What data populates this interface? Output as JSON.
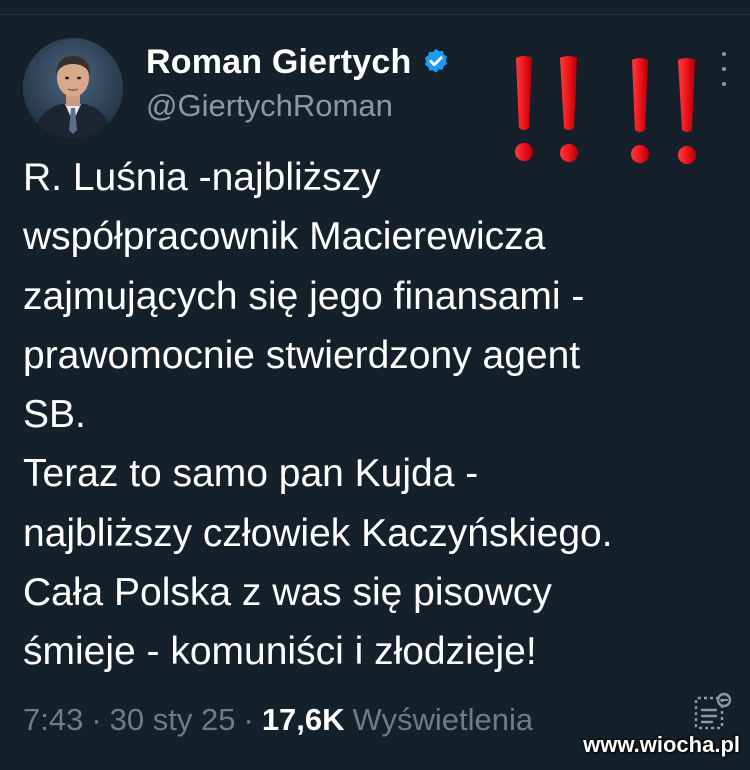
{
  "tweet": {
    "author": {
      "display_name": "Roman Giertych",
      "handle": "@GiertychRoman",
      "verified": true,
      "verified_color": "#1d9bf0"
    },
    "text_lines": [
      "R. Luśnia -najbliższy",
      "współpracownik Macierewicza",
      "zajmujących się jego finansami -",
      "prawomocnie stwierdzony agent",
      "SB.",
      "Teraz to samo pan Kujda -",
      "najbliższy człowiek Kaczyńskiego.",
      "Cała Polska z was się pisowcy",
      "śmieje - komuniści i złodzieje!"
    ],
    "meta": {
      "time": "7:43",
      "separator": "·",
      "date": "30 sty 25",
      "views_count": "17,6K",
      "views_label": "Wyświetlenia"
    }
  },
  "overlay": {
    "exclamation_color": "#e8121a",
    "exclamation_count": 4
  },
  "watermark": {
    "text": "www.wiocha.pl"
  },
  "theme": {
    "background": "#15202b",
    "text": "#ffffff",
    "secondary_text": "#8b98a5"
  },
  "icons": {
    "verified": "verified-badge-icon",
    "more": "more-options-icon",
    "analytics": "analytics-icon"
  }
}
